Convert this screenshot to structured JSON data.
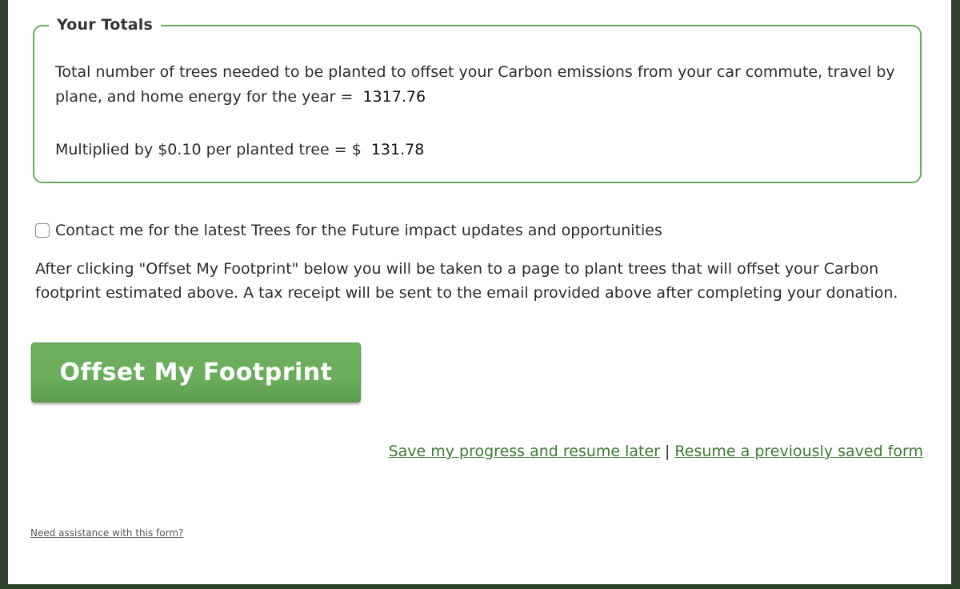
{
  "totals": {
    "legend": "Your Totals",
    "trees_text": "Total number of trees needed to be planted to offset your Carbon emissions from your car commute, travel by plane, and home energy for the year =",
    "trees_value": "1317.76",
    "cost_text": "Multiplied by $0.10 per planted tree = $",
    "cost_value": "131.78"
  },
  "contact": {
    "label": "Contact me for the latest Trees for the Future impact updates and opportunities",
    "checked": false
  },
  "info_text": "After clicking \"Offset My Footprint\" below you will be taken to a page to plant trees that will offset your Carbon footprint estimated above. A tax receipt will be sent to the email provided above after completing your donation.",
  "offset_button_label": "Offset My Footprint",
  "links": {
    "save_label": "Save my progress and resume later",
    "separator": "|",
    "resume_label": "Resume a previously saved form"
  },
  "assist_label": "Need assistance with this form?",
  "colors": {
    "accent": "#6aaa5c",
    "link": "#3b7a2e",
    "frame": "#2e3f2c"
  }
}
